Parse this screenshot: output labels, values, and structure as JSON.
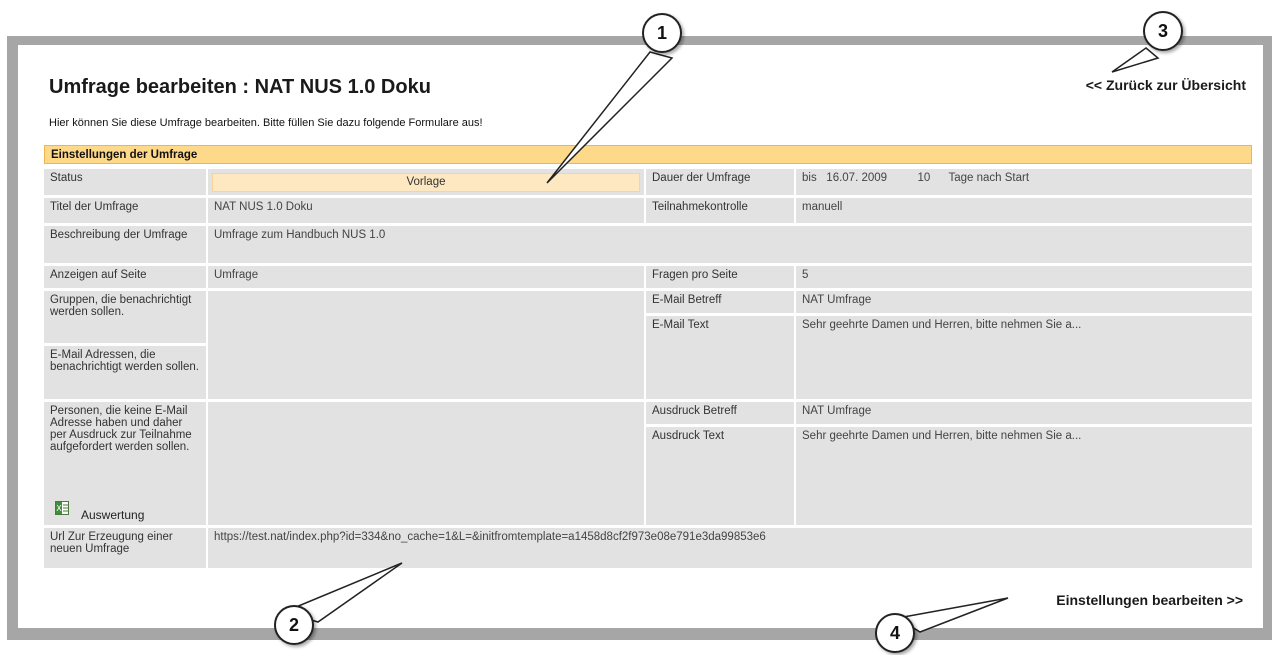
{
  "page": {
    "title": "Umfrage bearbeiten : NAT NUS 1.0 Doku",
    "back_link": "<< Zurück zur Übersicht",
    "intro": "Hier können Sie diese Umfrage bearbeiten. Bitte füllen Sie dazu folgende Formulare aus!",
    "section_header": "Einstellungen der Umfrage",
    "edit_link": "Einstellungen bearbeiten >>"
  },
  "fields": {
    "status_label": "Status",
    "status_value": "Vorlage",
    "dauer_label": "Dauer der Umfrage",
    "dauer_bis": "bis",
    "dauer_date": "16.07. 2009",
    "dauer_days": "10",
    "dauer_suffix": "Tage nach Start",
    "titel_label": "Titel der Umfrage",
    "titel_value": "NAT NUS 1.0 Doku",
    "teilnahme_label": "Teilnahmekontrolle",
    "teilnahme_value": "manuell",
    "beschreibung_label": "Beschreibung der Umfrage",
    "beschreibung_value": "Umfrage zum Handbuch NUS 1.0",
    "anzeigen_label": "Anzeigen auf Seite",
    "anzeigen_value": "Umfrage",
    "fragen_label": "Fragen pro Seite",
    "fragen_value": "5",
    "gruppen_label": "Gruppen, die benachrichtigt werden sollen.",
    "email_betreff_label": "E-Mail Betreff",
    "email_betreff_value": "NAT Umfrage",
    "email_text_label": "E-Mail Text",
    "email_text_value": "Sehr geehrte Damen und Herren, bitte nehmen Sie a...",
    "email_adressen_label": "E-Mail Adressen, die benachrichtigt werden sollen.",
    "personen_label": "Personen, die keine E-Mail Adresse haben und daher per Ausdruck zur Teilnahme aufgefordert werden sollen.",
    "ausdruck_betreff_label": "Ausdruck Betreff",
    "ausdruck_betreff_value": "NAT Umfrage",
    "ausdruck_text_label": "Ausdruck Text",
    "ausdruck_text_value": "Sehr geehrte Damen und Herren, bitte nehmen Sie a...",
    "auswertung_label": "Auswertung",
    "url_label": "Url Zur Erzeugung einer neuen Umfrage",
    "url_value": "https://test.nat/index.php?id=334&no_cache=1&L=&initfromtemplate=a1458d8cf2f973e08e791e3da99853e6"
  },
  "callouts": {
    "c1": "1",
    "c2": "2",
    "c3": "3",
    "c4": "4"
  },
  "icons": {
    "auswertung_icon": "excel-icon"
  }
}
